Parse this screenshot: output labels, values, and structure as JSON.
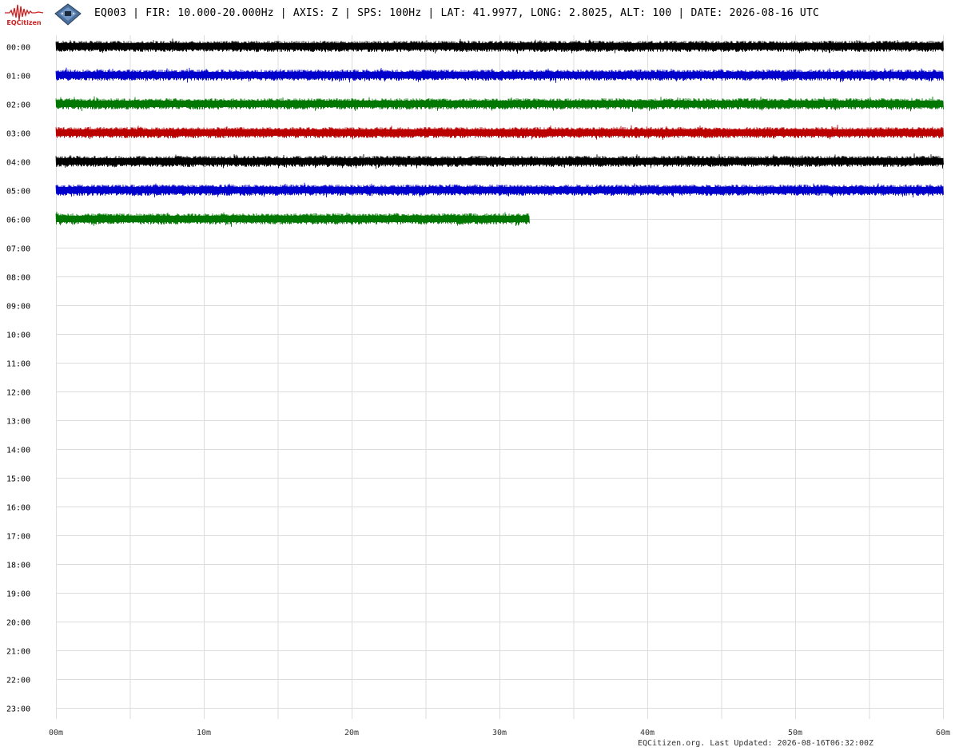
{
  "header": {
    "logo_text": "EQCitizen",
    "title": "EQ003 | FIR: 10.000-20.000Hz | AXIS: Z | SPS: 100Hz | LAT: 41.9977, LONG: 2.8025, ALT: 100 | DATE: 2026-08-16 UTC"
  },
  "footer": {
    "text": "EQCitizen.org. Last Updated: 2026-08-16T06:32:00Z"
  },
  "colors": {
    "trace_cycle": [
      "#000000",
      "#0000cc",
      "#007700",
      "#bb0000"
    ],
    "grid": "#dddddd",
    "logo": "#cc1f1f"
  },
  "chart_data": {
    "type": "line",
    "title": "EQ003 | FIR: 10.000-20.000Hz | AXIS: Z | SPS: 100Hz | LAT: 41.9977, LONG: 2.8025, ALT: 100 | DATE: 2026-08-16 UTC",
    "xlabel": "",
    "ylabel": "",
    "x_ticks": [
      "00m",
      "10m",
      "20m",
      "30m",
      "40m",
      "50m",
      "60m"
    ],
    "x_range_minutes": [
      0,
      60
    ],
    "x_minor_step_minutes": 5,
    "y_tick_labels": [
      "00:00",
      "01:00",
      "02:00",
      "03:00",
      "04:00",
      "05:00",
      "06:00",
      "07:00",
      "08:00",
      "09:00",
      "10:00",
      "11:00",
      "12:00",
      "13:00",
      "14:00",
      "15:00",
      "16:00",
      "17:00",
      "18:00",
      "19:00",
      "20:00",
      "21:00",
      "22:00",
      "23:00"
    ],
    "grid": true,
    "legend": "none",
    "series": [
      {
        "hour": "00:00",
        "minutes_recorded": 60,
        "color": "#000000"
      },
      {
        "hour": "01:00",
        "minutes_recorded": 60,
        "color": "#0000cc"
      },
      {
        "hour": "02:00",
        "minutes_recorded": 60,
        "color": "#007700"
      },
      {
        "hour": "03:00",
        "minutes_recorded": 60,
        "color": "#bb0000"
      },
      {
        "hour": "04:00",
        "minutes_recorded": 60,
        "color": "#000000"
      },
      {
        "hour": "05:00",
        "minutes_recorded": 60,
        "color": "#0000cc"
      },
      {
        "hour": "06:00",
        "minutes_recorded": 32,
        "color": "#007700"
      }
    ]
  }
}
